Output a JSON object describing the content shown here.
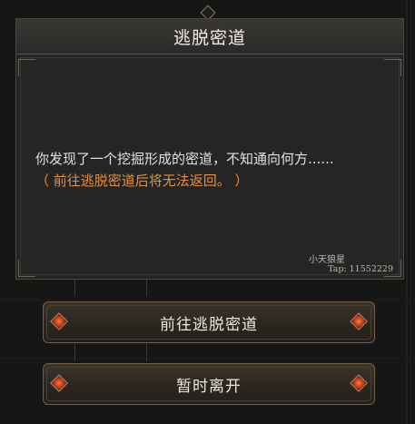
{
  "dialog": {
    "title": "逃脱密道",
    "message": "你发现了一个挖掘形成的密道，不知通向何方......",
    "warning": "（ 前往逃脱密道后将无法返回。 ）",
    "watermark_name": "小天狼星",
    "watermark_tap": "Tap: 11552229"
  },
  "buttons": {
    "go_label": "前往逃脱密道",
    "leave_label": "暂时离开"
  },
  "colors": {
    "warning": "#e8903a",
    "gem": "#ff7a3a",
    "panel": "#252525"
  }
}
